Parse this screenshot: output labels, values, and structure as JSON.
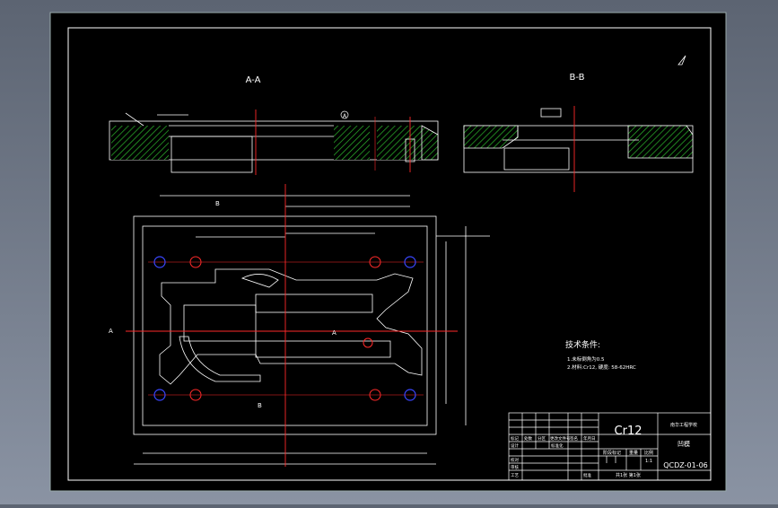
{
  "sections": {
    "aa_label": "A-A",
    "bb_label": "B-B"
  },
  "tech_requirements": {
    "title": "技术条件:",
    "items": [
      "1.未标倒角为0.5",
      "2.材料:Cr12, 硬度: 58-62HRC"
    ]
  },
  "title_block": {
    "material": "Cr12",
    "school": "南华工程学校",
    "part_name": "凹模",
    "drawing_no": "QCDZ-01-06",
    "scale_header": "比例",
    "scale_value": "1:1",
    "weight_header": "重量",
    "stage_marks_header": "阶段标记",
    "rev_headers": [
      "标记",
      "处数",
      "分区",
      "更改文件号",
      "签名",
      "年月日"
    ],
    "role_labels": [
      "设计",
      "校对",
      "审核",
      "工艺"
    ],
    "standardize_label": "标准化",
    "approve_label": "批准",
    "sheet_info": "共1张 第1张"
  },
  "markers": {
    "section_a": "A",
    "section_b": "B",
    "datum_a": "A"
  },
  "colors": {
    "frame": "#ffffff",
    "centerline": "#ff2a2a",
    "hatch": "#2db82d",
    "hole": "#3a46ff",
    "dimension": "#ffffff"
  }
}
